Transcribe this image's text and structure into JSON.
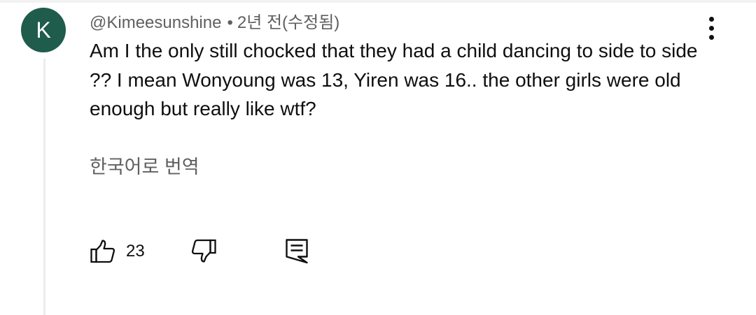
{
  "comment": {
    "avatar_letter": "K",
    "avatar_color": "#1f5c4c",
    "author": "@Kimeesunshine",
    "separator": "•",
    "timestamp": "2년 전(수정됨)",
    "text": "Am I the only still chocked that they had a child dancing to side to side ?? I mean Wonyoung was 13, Yiren was 16.. the other girls were old enough but really like wtf?",
    "translate_label": "한국어로 번역",
    "like_count": "23"
  },
  "icons": {
    "like": "thumb-up-icon",
    "dislike": "thumb-down-icon",
    "reply": "reply-comment-icon",
    "menu": "more-vert-icon"
  }
}
